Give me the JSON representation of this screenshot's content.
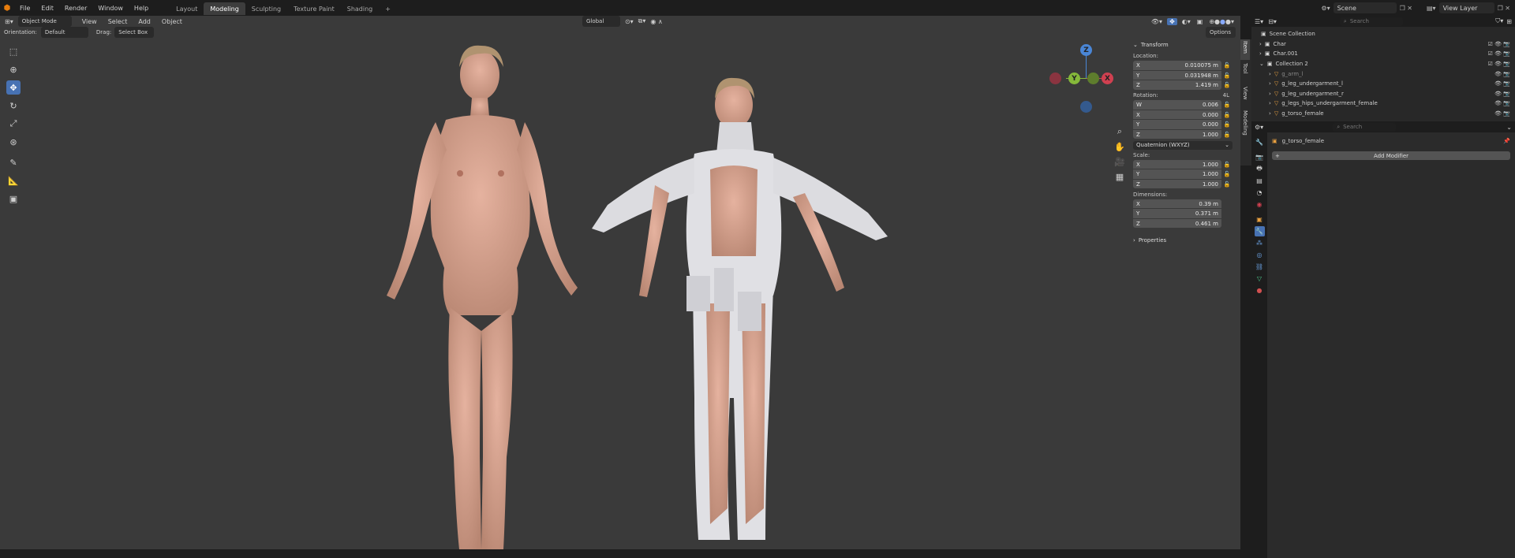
{
  "topbar": {
    "menus": [
      "File",
      "Edit",
      "Render",
      "Window",
      "Help"
    ],
    "workspaces": [
      "Layout",
      "Modeling",
      "Sculpting",
      "Texture Paint",
      "Shading"
    ],
    "active_workspace": "Modeling",
    "add_tab": "+",
    "scene": "Scene",
    "view_layer": "View Layer"
  },
  "viewport_header": {
    "mode": "Object Mode",
    "menus": [
      "View",
      "Select",
      "Add",
      "Object"
    ],
    "transform_orientation": "Global",
    "orientation_label": "Orientation:",
    "orientation_value": "Default",
    "drag_label": "Drag:",
    "drag_value": "Select Box",
    "options": "Options"
  },
  "gizmo": {
    "z": "Z",
    "y": "Y",
    "x": "X"
  },
  "npanel": {
    "tabs": [
      "Item",
      "Tool",
      "View",
      "Modeling"
    ],
    "transform_title": "Transform",
    "location_label": "Location:",
    "location": [
      {
        "axis": "X",
        "value": "0.010075 m"
      },
      {
        "axis": "Y",
        "value": "0.031948 m"
      },
      {
        "axis": "Z",
        "value": "1.419 m"
      }
    ],
    "rotation_label": "Rotation:",
    "rotation_mode_tag": "4L",
    "rotation": [
      {
        "axis": "W",
        "value": "0.006"
      },
      {
        "axis": "X",
        "value": "0.000"
      },
      {
        "axis": "Y",
        "value": "0.000"
      },
      {
        "axis": "Z",
        "value": "1.000"
      }
    ],
    "rotation_mode": "Quaternion (WXYZ)",
    "scale_label": "Scale:",
    "scale": [
      {
        "axis": "X",
        "value": "1.000"
      },
      {
        "axis": "Y",
        "value": "1.000"
      },
      {
        "axis": "Z",
        "value": "1.000"
      }
    ],
    "dimensions_label": "Dimensions:",
    "dimensions": [
      {
        "axis": "X",
        "value": "0.39 m"
      },
      {
        "axis": "Y",
        "value": "0.371 m"
      },
      {
        "axis": "Z",
        "value": "0.461 m"
      }
    ],
    "properties": "Properties"
  },
  "outliner": {
    "search_placeholder": "Search",
    "root": "Scene Collection",
    "items": [
      {
        "label": "Char",
        "indent": 1
      },
      {
        "label": "Char.001",
        "indent": 1
      },
      {
        "label": "Collection 2",
        "indent": 1
      },
      {
        "label": "g_arm_l",
        "indent": 2
      },
      {
        "label": "g_leg_undergarment_l",
        "indent": 2
      },
      {
        "label": "g_leg_undergarment_r",
        "indent": 2
      },
      {
        "label": "g_legs_hips_undergarment_female",
        "indent": 2
      },
      {
        "label": "g_torso_female",
        "indent": 2
      }
    ]
  },
  "properties": {
    "search_placeholder": "Search",
    "object_name": "g_torso_female",
    "add_modifier": "Add Modifier"
  }
}
